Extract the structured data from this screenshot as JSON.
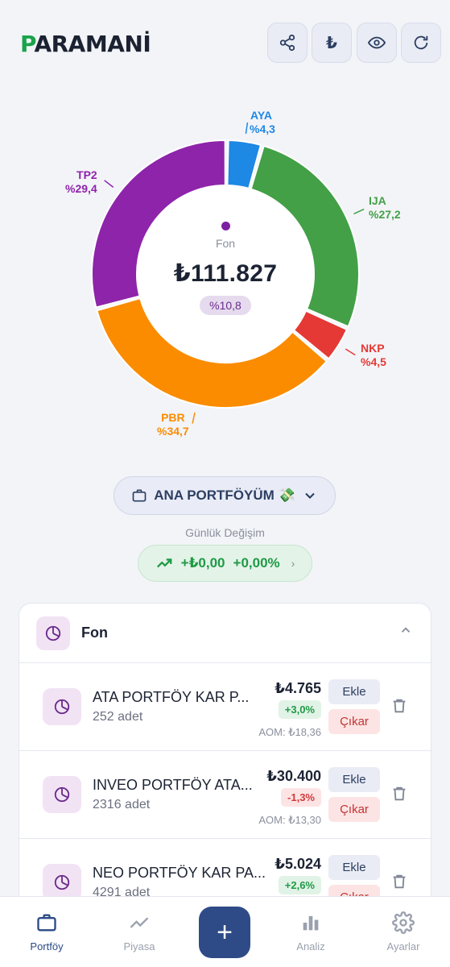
{
  "app": {
    "logo_first": "P",
    "logo_rest": "ARAMANİ"
  },
  "header": {
    "currency_symbol": "₺",
    "icons": [
      "share-icon",
      "currency-icon",
      "eye-icon",
      "refresh-icon"
    ]
  },
  "chart_data": {
    "type": "pie",
    "donut": true,
    "slices": [
      {
        "label": "AYA",
        "value": 4.3,
        "display": "%4,3",
        "color": "#1e88e5"
      },
      {
        "label": "IJA",
        "value": 27.2,
        "display": "%27,2",
        "color": "#43a047"
      },
      {
        "label": "NKP",
        "value": 4.5,
        "display": "%4,5",
        "color": "#e53935"
      },
      {
        "label": "PBR",
        "value": 34.7,
        "display": "%34,7",
        "color": "#fb8c00"
      },
      {
        "label": "TP2",
        "value": 29.4,
        "display": "%29,4",
        "color": "#8e24aa"
      }
    ],
    "center": {
      "category": "Fon",
      "total": "₺111.827",
      "percent": "%10,8"
    }
  },
  "portfolio": {
    "name": "ANA PORTFÖYÜM 💸",
    "daily_label": "Günlük Değişim",
    "daily_amount": "+₺0,00",
    "daily_percent": "+0,00%"
  },
  "card": {
    "title": "Fon",
    "items": [
      {
        "name": "ATA PORTFÖY KAR P...",
        "qty": "252 adet",
        "price": "₺4.765",
        "change": "+3,0%",
        "direction": "up",
        "aom": "AOM: ₺18,36",
        "add": "Ekle",
        "remove": "Çıkar"
      },
      {
        "name": "INVEO PORTFÖY ATA...",
        "qty": "2316 adet",
        "price": "₺30.400",
        "change": "-1,3%",
        "direction": "down",
        "aom": "AOM: ₺13,30",
        "add": "Ekle",
        "remove": "Çıkar"
      },
      {
        "name": "NEO PORTFÖY KAR PA...",
        "qty": "4291 adet",
        "price": "₺5.024",
        "change": "+2,6%",
        "direction": "up",
        "aom": "",
        "add": "Ekle",
        "remove": "Çıkar"
      }
    ]
  },
  "tabbar": {
    "portfoy": "Portföy",
    "piyasa": "Piyasa",
    "add": "+",
    "analiz": "Analiz",
    "ayarlar": "Ayarlar"
  }
}
